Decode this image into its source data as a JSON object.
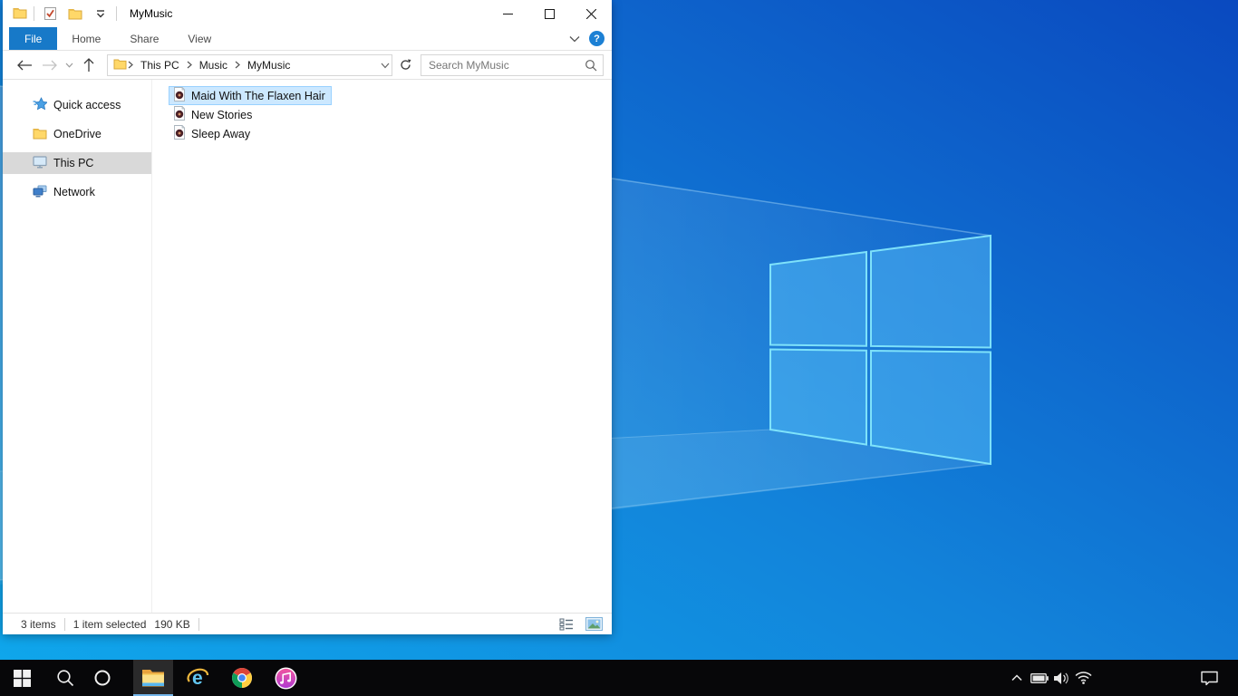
{
  "window": {
    "title": "MyMusic",
    "tabs": [
      {
        "label": "File",
        "active": true
      },
      {
        "label": "Home",
        "active": false
      },
      {
        "label": "Share",
        "active": false
      },
      {
        "label": "View",
        "active": false
      }
    ],
    "help_glyph": "?",
    "breadcrumb": [
      "This PC",
      "Music",
      "MyMusic"
    ],
    "search_placeholder": "Search MyMusic",
    "sidebar": [
      {
        "label": "Quick access",
        "icon": "quick-access-star",
        "selected": false
      },
      {
        "label": "OneDrive",
        "icon": "onedrive-folder",
        "selected": false
      },
      {
        "label": "This PC",
        "icon": "this-pc-monitor",
        "selected": true
      },
      {
        "label": "Network",
        "icon": "network-computers",
        "selected": false
      }
    ],
    "files": [
      {
        "name": "Maid With The Flaxen Hair",
        "icon": "music-file",
        "selected": true
      },
      {
        "name": "New Stories",
        "icon": "music-file",
        "selected": false
      },
      {
        "name": "Sleep Away",
        "icon": "music-file",
        "selected": false
      }
    ],
    "status": {
      "items": "3 items",
      "selected": "1 item selected",
      "size": "190 KB"
    }
  },
  "taskbar": {
    "items": [
      {
        "name": "start"
      },
      {
        "name": "search"
      },
      {
        "name": "cortana"
      },
      {
        "name": "file-explorer",
        "active": true
      },
      {
        "name": "internet-explorer"
      },
      {
        "name": "chrome"
      },
      {
        "name": "itunes"
      }
    ],
    "tray": [
      "tray-expand",
      "battery",
      "volume",
      "wifi",
      "action-center"
    ]
  },
  "colors": {
    "file_tab_blue": "#1779c8",
    "selection_fill": "#cce8ff",
    "selection_border": "#99d1ff",
    "sidebar_selected_gray": "#d9d9d9",
    "taskbar_black": "#070709",
    "active_app_underline": "#75b6ea",
    "wallpaper_bright": "#0fa8ec",
    "wallpaper_dark": "#0a49bf"
  }
}
